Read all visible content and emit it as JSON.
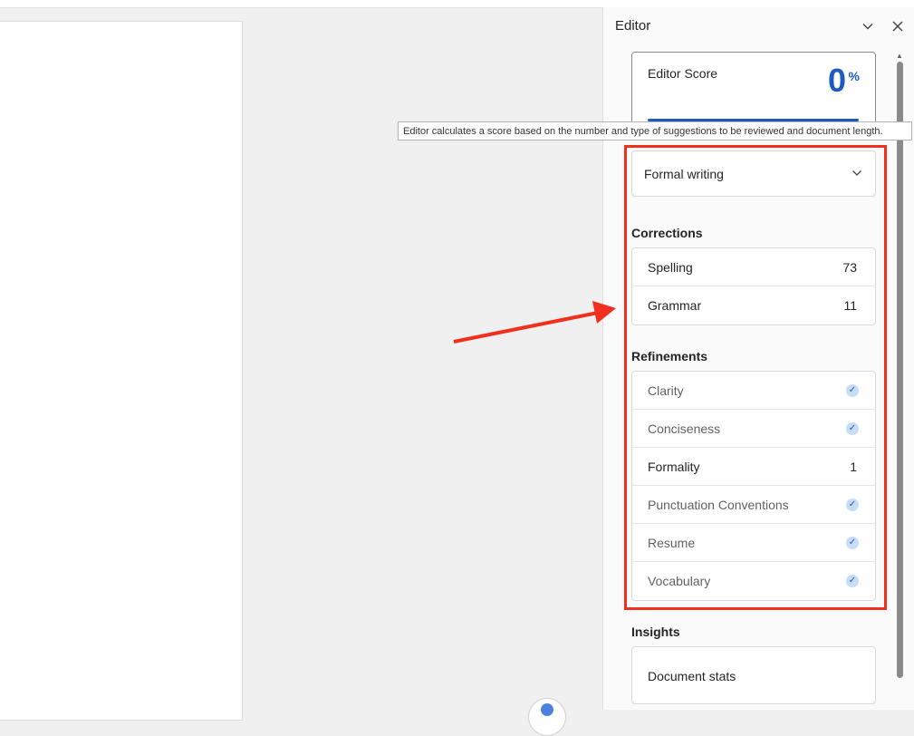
{
  "colors": {
    "accent": "#1f5bbf",
    "highlight_box": "#f0301c",
    "check_bg": "#c7dcf5"
  },
  "pane": {
    "title": "Editor",
    "collapse_icon": "chevron-down-icon",
    "close_icon": "close-icon"
  },
  "score": {
    "label": "Editor Score",
    "value": "0",
    "unit": "%"
  },
  "tooltip": {
    "text": "Editor calculates a score based on the number and type of suggestions to be reviewed and document length."
  },
  "writing_style": {
    "selected": "Formal writing"
  },
  "corrections": {
    "heading": "Corrections",
    "items": [
      {
        "label": "Spelling",
        "count": "73"
      },
      {
        "label": "Grammar",
        "count": "11"
      }
    ]
  },
  "refinements": {
    "heading": "Refinements",
    "items": [
      {
        "label": "Clarity",
        "status": "check"
      },
      {
        "label": "Conciseness",
        "status": "check"
      },
      {
        "label": "Formality",
        "count": "1"
      },
      {
        "label": "Punctuation Conventions",
        "status": "check"
      },
      {
        "label": "Resume",
        "status": "check"
      },
      {
        "label": "Vocabulary",
        "status": "check"
      }
    ]
  },
  "insights": {
    "heading": "Insights",
    "items": [
      {
        "label": "Document stats"
      }
    ]
  }
}
